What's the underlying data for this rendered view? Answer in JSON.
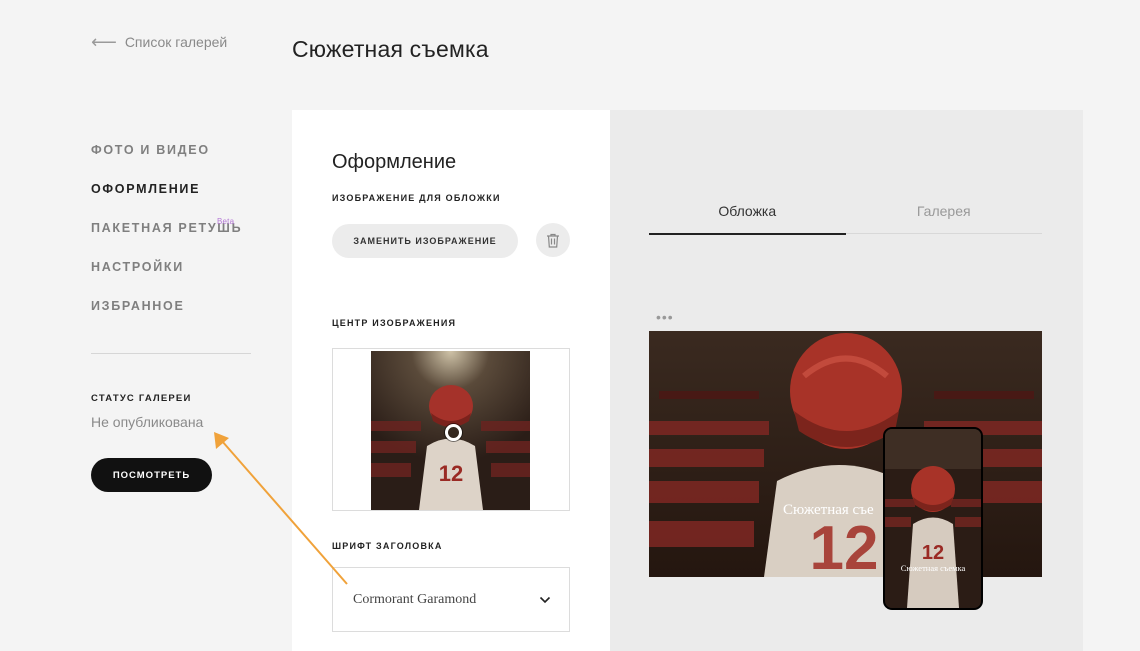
{
  "header": {
    "back_label": "Список галерей",
    "page_title": "Сюжетная съемка"
  },
  "sidebar": {
    "items": [
      {
        "label": "ФОТО И ВИДЕО"
      },
      {
        "label": "ОФОРМЛЕНИЕ"
      },
      {
        "label": "ПАКЕТНАЯ РЕТУШЬ",
        "badge": "Beta"
      },
      {
        "label": "НАСТРОЙКИ"
      },
      {
        "label": "ИЗБРАННОЕ"
      }
    ],
    "status_label": "СТАТУС ГАЛЕРЕИ",
    "status_value": "Не опубликована",
    "view_button": "ПОСМОТРЕТЬ"
  },
  "design_panel": {
    "title": "Оформление",
    "cover_image_label": "ИЗОБРАЖЕНИЕ ДЛЯ ОБЛОЖКИ",
    "replace_button": "ЗАМЕНИТЬ ИЗОБРАЖЕНИЕ",
    "focal_label": "ЦЕНТР ИЗОБРАЖЕНИЯ",
    "font_label": "ШРИФТ ЗАГОЛОВКА",
    "font_value": "Cormorant Garamond"
  },
  "preview": {
    "tabs": [
      {
        "label": "Обложка"
      },
      {
        "label": "Галерея"
      }
    ],
    "desktop_title": "Сюжетная съе",
    "phone_title": "Сюжетная съемка"
  },
  "colors": {
    "accent": "#111111",
    "beta": "#b57ad6",
    "annotation": "#f0a23a",
    "helmet": "#b0362a"
  }
}
